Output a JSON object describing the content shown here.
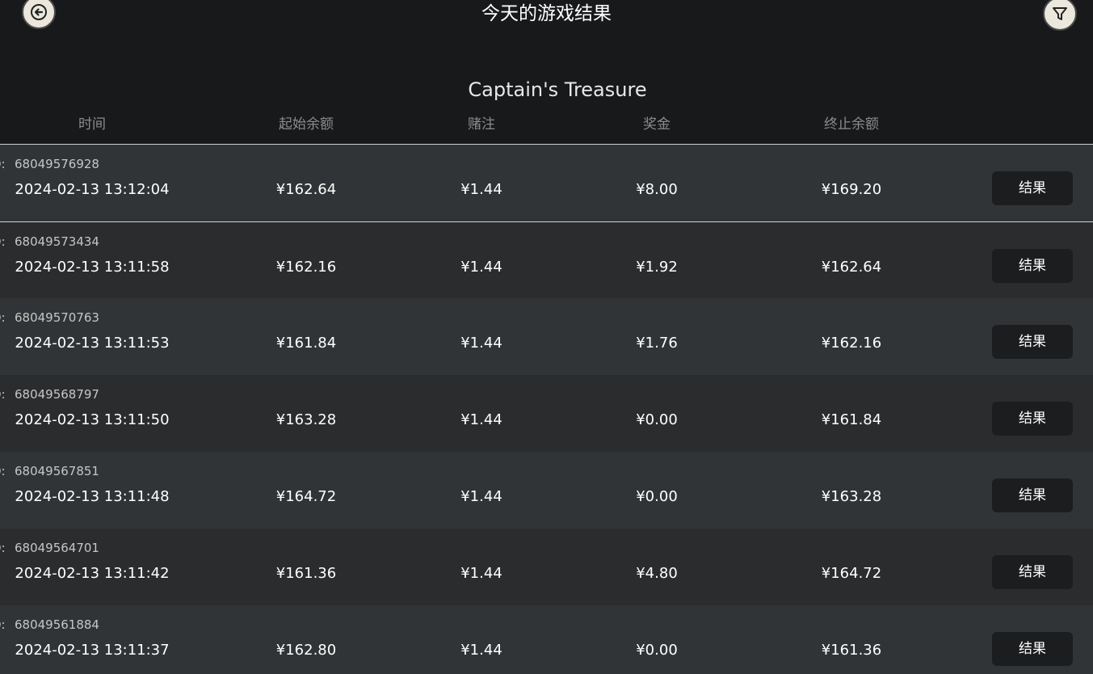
{
  "header": {
    "title": "今天的游戏结果",
    "back_icon": "arrow-left-icon",
    "filter_icon": "filter-icon"
  },
  "game_title": "Captain's Treasure",
  "columns": {
    "time": "时间",
    "start_balance": "起始余额",
    "bet": "赌注",
    "prize": "奖金",
    "end_balance": "终止余额"
  },
  "id_prefix": "D:",
  "result_label": "结果",
  "rows": [
    {
      "id": "68049576928",
      "time": "2024-02-13 13:12:04",
      "start_balance": "¥162.64",
      "bet": "¥1.44",
      "prize": "¥8.00",
      "end_balance": "¥169.20"
    },
    {
      "id": "68049573434",
      "time": "2024-02-13 13:11:58",
      "start_balance": "¥162.16",
      "bet": "¥1.44",
      "prize": "¥1.92",
      "end_balance": "¥162.64"
    },
    {
      "id": "68049570763",
      "time": "2024-02-13 13:11:53",
      "start_balance": "¥161.84",
      "bet": "¥1.44",
      "prize": "¥1.76",
      "end_balance": "¥162.16"
    },
    {
      "id": "68049568797",
      "time": "2024-02-13 13:11:50",
      "start_balance": "¥163.28",
      "bet": "¥1.44",
      "prize": "¥0.00",
      "end_balance": "¥161.84"
    },
    {
      "id": "68049567851",
      "time": "2024-02-13 13:11:48",
      "start_balance": "¥164.72",
      "bet": "¥1.44",
      "prize": "¥0.00",
      "end_balance": "¥163.28"
    },
    {
      "id": "68049564701",
      "time": "2024-02-13 13:11:42",
      "start_balance": "¥161.36",
      "bet": "¥1.44",
      "prize": "¥4.80",
      "end_balance": "¥164.72"
    },
    {
      "id": "68049561884",
      "time": "2024-02-13 13:11:37",
      "start_balance": "¥162.80",
      "bet": "¥1.44",
      "prize": "¥0.00",
      "end_balance": "¥161.36"
    }
  ]
}
